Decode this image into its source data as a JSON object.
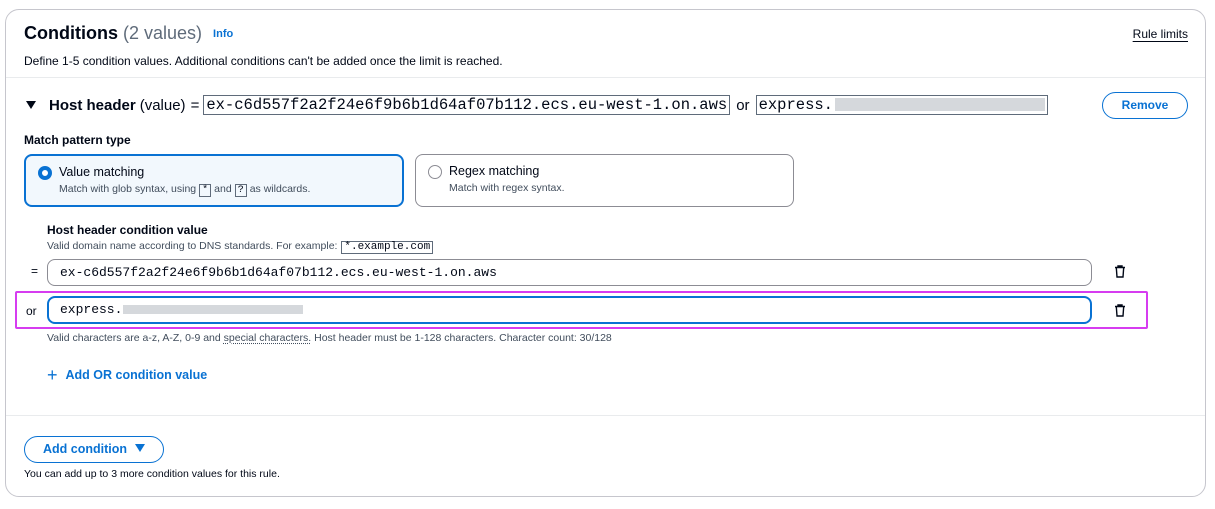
{
  "header": {
    "title": "Conditions",
    "count": "(2 values)",
    "info_link": "Info",
    "rule_limits": "Rule limits",
    "description": "Define 1-5 condition values. Additional conditions can't be added once the limit is reached."
  },
  "condition": {
    "label": "Host header",
    "value_suffix": "(value)",
    "equals": "=",
    "value1": "ex-c6d557f2a2f24e6f9b6b1d64af07b112.ecs.eu-west-1.on.aws",
    "or_word": "or",
    "value2_visible": "express.",
    "remove_button": "Remove"
  },
  "match_pattern": {
    "label": "Match pattern type",
    "options": [
      {
        "title": "Value matching",
        "sub_before": "Match with glob syntax, using",
        "kbd1": "*",
        "and": "and",
        "kbd2": "?",
        "sub_after": "as wildcards.",
        "selected": true
      },
      {
        "title": "Regex matching",
        "sub": "Match with regex syntax.",
        "selected": false
      }
    ]
  },
  "host_value": {
    "label": "Host header condition value",
    "desc": "Valid domain name according to DNS standards. For example:",
    "example": "*.example.com",
    "rows": [
      {
        "prefix": "=",
        "value": "ex-c6d557f2a2f24e6f9b6b1d64af07b112.ecs.eu-west-1.on.aws"
      },
      {
        "prefix": "or",
        "value": "express."
      }
    ],
    "valid_prefix": "Valid characters are a-z, A-Z, 0-9 and",
    "valid_link": "special characters.",
    "valid_suffix": "Host header must be 1-128 characters. Character count: 30/128",
    "add_or": "Add OR condition value"
  },
  "footer": {
    "add_condition": "Add condition",
    "note": "You can add up to 3 more condition values for this rule."
  },
  "colors": {
    "accent": "#0972d3",
    "highlight": "#d63cf0",
    "border": "#c6c6cd"
  }
}
